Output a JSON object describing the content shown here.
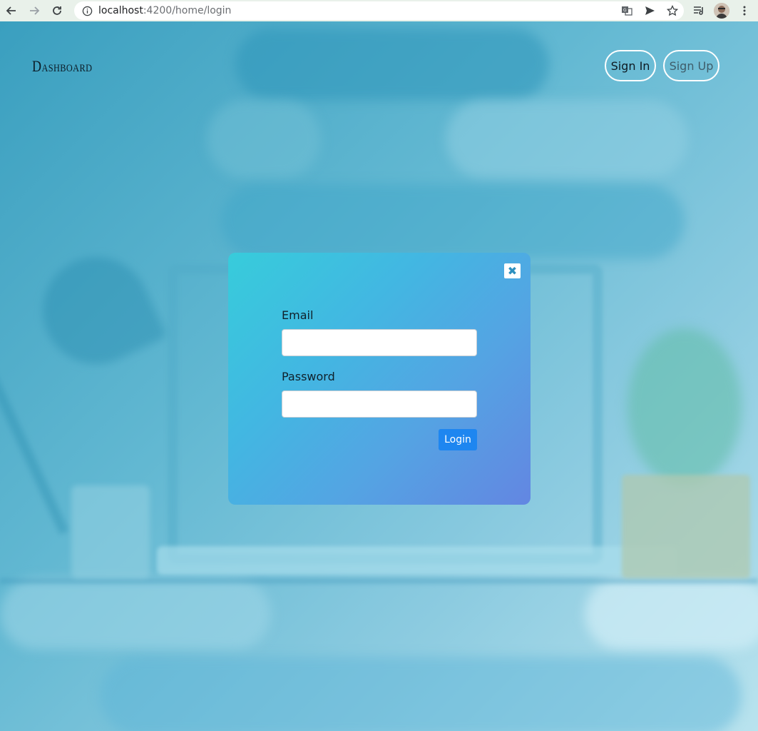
{
  "browser": {
    "url_host": "localhost",
    "url_rest": ":4200/home/login"
  },
  "header": {
    "brand": "Dashboard",
    "sign_in_label": "Sign In",
    "sign_up_label": "Sign Up"
  },
  "modal": {
    "close_symbol": "✖",
    "email_label": "Email",
    "email_value": "",
    "password_label": "Password",
    "password_value": "",
    "login_label": "Login"
  },
  "colors": {
    "accent": "#1e86f0",
    "modal_gradient_start": "#37ccdb",
    "modal_gradient_end": "#6386e2"
  },
  "icons": {
    "back": "arrow-left-icon",
    "forward": "arrow-right-icon",
    "reload": "reload-icon",
    "info": "info-icon",
    "translate": "translate-icon",
    "send": "send-icon",
    "bookmark": "star-icon",
    "reading_list": "reading-list-icon",
    "menu": "kebab-menu-icon"
  }
}
